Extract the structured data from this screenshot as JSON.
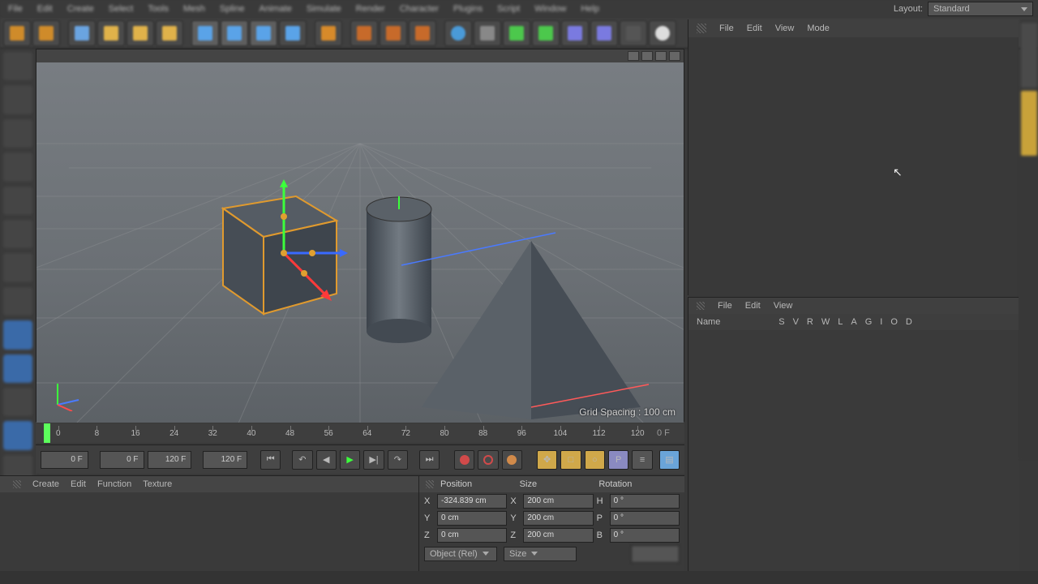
{
  "menubar": {
    "items": [
      "File",
      "Edit",
      "Create",
      "Select",
      "Tools",
      "Mesh",
      "Spline",
      "Animate",
      "Simulate",
      "Render",
      "Character",
      "Plugins",
      "Script",
      "Window",
      "Help"
    ]
  },
  "layout": {
    "label": "Layout:",
    "value": "Standard"
  },
  "viewport": {
    "grid_spacing_label": "Grid Spacing : 100 cm"
  },
  "timeline": {
    "ticks": [
      "0",
      "8",
      "16",
      "24",
      "32",
      "40",
      "48",
      "56",
      "64",
      "72",
      "80",
      "88",
      "96",
      "104",
      "112",
      "120"
    ],
    "frame_field": "0 F",
    "start_field": "0 F",
    "end_field1": "120 F",
    "end_field2": "120 F"
  },
  "object_manager": {
    "menu": {
      "file": "File",
      "edit": "Edit",
      "view": "View",
      "mode": "Mode"
    }
  },
  "attribute_manager": {
    "menu": {
      "file": "File",
      "edit": "Edit",
      "view": "View"
    },
    "name_label": "Name",
    "col_flags": [
      "S",
      "V",
      "R",
      "W",
      "L",
      "A",
      "G",
      "I",
      "O",
      "D"
    ]
  },
  "bottom_tabs": {
    "create": "Create",
    "edit": "Edit",
    "function": "Function",
    "texture": "Texture"
  },
  "coords": {
    "header": {
      "position": "Position",
      "size": "Size",
      "rotation": "Rotation"
    },
    "x": {
      "label": "X",
      "pos": "-324.839 cm",
      "size": "200 cm",
      "rot": "0 °"
    },
    "y": {
      "label": "Y",
      "pos": "0 cm",
      "size": "200 cm",
      "rot": "0 °"
    },
    "z": {
      "label": "Z",
      "pos": "0 cm",
      "size": "200 cm",
      "rot": "0 °"
    },
    "mode": {
      "object": "Object (Rel)",
      "size": "Size"
    },
    "lbl2": {
      "x": "X",
      "y": "Y",
      "z": "Z",
      "h": "H",
      "p": "P",
      "b": "B"
    }
  }
}
